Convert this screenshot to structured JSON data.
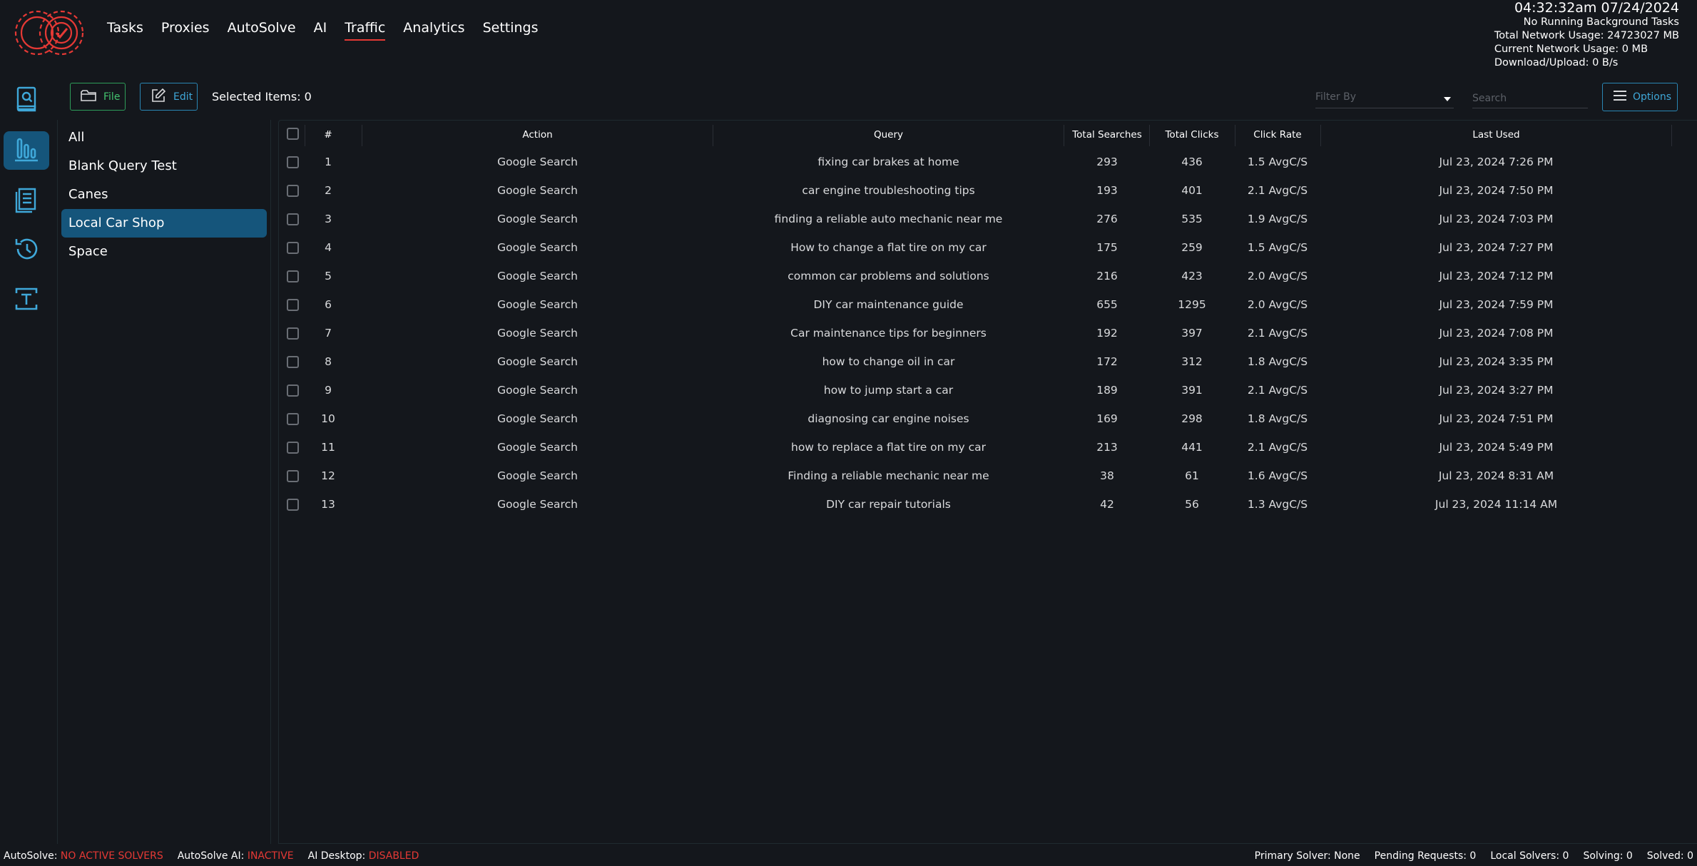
{
  "nav": {
    "items": [
      {
        "label": "Tasks"
      },
      {
        "label": "Proxies"
      },
      {
        "label": "AutoSolve"
      },
      {
        "label": "AI"
      },
      {
        "label": "Traffic",
        "active": true
      },
      {
        "label": "Analytics"
      },
      {
        "label": "Settings"
      }
    ]
  },
  "status": {
    "clock": "04:32:32am 07/24/2024",
    "background_tasks": "No Running Background Tasks",
    "total_network": "Total Network Usage:  24723027 MB",
    "current_network": "Current Network Usage: 0 MB",
    "download_upload": "Download/Upload: 0 B/s"
  },
  "rail": {
    "items": [
      {
        "icon": "search-book-icon"
      },
      {
        "icon": "bar-chart-icon",
        "active": true
      },
      {
        "icon": "document-list-icon"
      },
      {
        "icon": "history-icon"
      },
      {
        "icon": "text-box-icon"
      }
    ]
  },
  "toolbar": {
    "file_label": "File",
    "edit_label": "Edit",
    "selected_items": "Selected Items: 0",
    "filter_placeholder": "Filter By",
    "search_placeholder": "Search",
    "options_label": "Options"
  },
  "groups": [
    {
      "label": "All"
    },
    {
      "label": "Blank Query Test"
    },
    {
      "label": "Canes"
    },
    {
      "label": "Local Car Shop",
      "active": true
    },
    {
      "label": "Space"
    }
  ],
  "table": {
    "headers": {
      "num": "#",
      "action": "Action",
      "query": "Query",
      "total_searches": "Total Searches",
      "total_clicks": "Total Clicks",
      "click_rate": "Click Rate",
      "last_used": "Last Used"
    },
    "rows": [
      {
        "num": "1",
        "action": "Google Search",
        "query": "fixing car brakes at home",
        "searches": "293",
        "clicks": "436",
        "rate": "1.5 AvgC/S",
        "last_used": "Jul 23, 2024 7:26 PM"
      },
      {
        "num": "2",
        "action": "Google Search",
        "query": "car engine troubleshooting tips",
        "searches": "193",
        "clicks": "401",
        "rate": "2.1 AvgC/S",
        "last_used": "Jul 23, 2024 7:50 PM"
      },
      {
        "num": "3",
        "action": "Google Search",
        "query": "finding a reliable auto mechanic near me",
        "searches": "276",
        "clicks": "535",
        "rate": "1.9 AvgC/S",
        "last_used": "Jul 23, 2024 7:03 PM"
      },
      {
        "num": "4",
        "action": "Google Search",
        "query": "How to change a flat tire on my car",
        "searches": "175",
        "clicks": "259",
        "rate": "1.5 AvgC/S",
        "last_used": "Jul 23, 2024 7:27 PM"
      },
      {
        "num": "5",
        "action": "Google Search",
        "query": "common car problems and solutions",
        "searches": "216",
        "clicks": "423",
        "rate": "2.0 AvgC/S",
        "last_used": "Jul 23, 2024 7:12 PM"
      },
      {
        "num": "6",
        "action": "Google Search",
        "query": "DIY car maintenance guide",
        "searches": "655",
        "clicks": "1295",
        "rate": "2.0 AvgC/S",
        "last_used": "Jul 23, 2024 7:59 PM"
      },
      {
        "num": "7",
        "action": "Google Search",
        "query": "Car maintenance tips for beginners",
        "searches": "192",
        "clicks": "397",
        "rate": "2.1 AvgC/S",
        "last_used": "Jul 23, 2024 7:08 PM"
      },
      {
        "num": "8",
        "action": "Google Search",
        "query": "how to change oil in car",
        "searches": "172",
        "clicks": "312",
        "rate": "1.8 AvgC/S",
        "last_used": "Jul 23, 2024 3:35 PM"
      },
      {
        "num": "9",
        "action": "Google Search",
        "query": "how to jump start a car",
        "searches": "189",
        "clicks": "391",
        "rate": "2.1 AvgC/S",
        "last_used": "Jul 23, 2024 3:27 PM"
      },
      {
        "num": "10",
        "action": "Google Search",
        "query": "diagnosing car engine noises",
        "searches": "169",
        "clicks": "298",
        "rate": "1.8 AvgC/S",
        "last_used": "Jul 23, 2024 7:51 PM"
      },
      {
        "num": "11",
        "action": "Google Search",
        "query": "how to replace a flat tire on my car",
        "searches": "213",
        "clicks": "441",
        "rate": "2.1 AvgC/S",
        "last_used": "Jul 23, 2024 5:49 PM"
      },
      {
        "num": "12",
        "action": "Google Search",
        "query": "Finding a reliable mechanic near me",
        "searches": "38",
        "clicks": "61",
        "rate": "1.6 AvgC/S",
        "last_used": "Jul 23, 2024 8:31 AM"
      },
      {
        "num": "13",
        "action": "Google Search",
        "query": "DIY car repair tutorials",
        "searches": "42",
        "clicks": "56",
        "rate": "1.3 AvgC/S",
        "last_used": "Jul 23, 2024 11:14 AM"
      }
    ]
  },
  "bottom": {
    "autosolve_label": "AutoSolve:",
    "autosolve_value": "NO ACTIVE SOLVERS",
    "autosolve_ai_label": "AutoSolve AI:",
    "autosolve_ai_value": "INACTIVE",
    "ai_desktop_label": "AI Desktop:",
    "ai_desktop_value": "DISABLED",
    "primary_solver": "Primary Solver: None",
    "pending_requests": "Pending Requests: 0",
    "local_solvers": "Local Solvers: 0",
    "solving": "Solving: 0",
    "solved": "Solved: 0"
  },
  "colors": {
    "background": "#14171c",
    "accent_blue": "#15557b",
    "accent_red": "#e53935",
    "file_green": "#43c46f",
    "edit_blue": "#3fa8d9"
  }
}
